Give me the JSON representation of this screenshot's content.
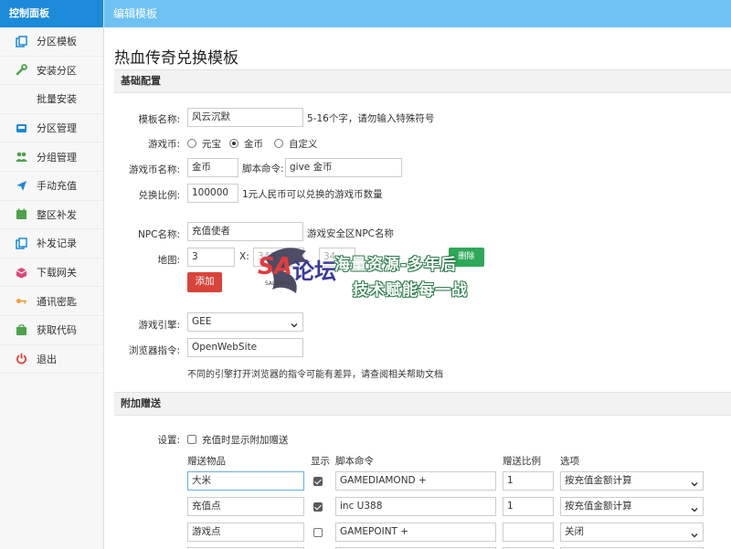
{
  "sidebar": {
    "title": "控制面板",
    "items": [
      {
        "label": "分区模板",
        "icon": "copy-icon",
        "color": "#1a8ad9"
      },
      {
        "label": "安装分区",
        "icon": "wrench-icon",
        "color": "#4aa34a"
      },
      {
        "label": "批量安装",
        "icon": "",
        "color": ""
      },
      {
        "label": "分区管理",
        "icon": "inbox-icon",
        "color": "#1a8ad9"
      },
      {
        "label": "分组管理",
        "icon": "users-icon",
        "color": "#4aa34a"
      },
      {
        "label": "手动充值",
        "icon": "send-icon",
        "color": "#1a8ad9"
      },
      {
        "label": "整区补发",
        "icon": "calendar-icon",
        "color": "#4aa34a"
      },
      {
        "label": "补发记录",
        "icon": "copy-icon",
        "color": "#1a8ad9"
      },
      {
        "label": "下载网关",
        "icon": "box-icon",
        "color": "#e0457b"
      },
      {
        "label": "通讯密匙",
        "icon": "key-icon",
        "color": "#f0a030"
      },
      {
        "label": "获取代码",
        "icon": "code-icon",
        "color": "#4aa34a"
      },
      {
        "label": "退出",
        "icon": "power-icon",
        "color": "#d9443a"
      }
    ]
  },
  "topbar": {
    "title": "编辑模板"
  },
  "page": {
    "title": "热血传奇兑换模板"
  },
  "basic": {
    "section": "基础配置",
    "template_name_label": "模板名称:",
    "template_name_value": "风云沉默",
    "template_name_hint": "5-16个字，请勿输入特殊符号",
    "currency_label": "游戏币:",
    "currency_options": [
      "元宝",
      "金币",
      "自定义"
    ],
    "currency_name_label": "游戏币名称:",
    "currency_name_value": "金币",
    "script_cmd_label": "脚本命令:",
    "script_cmd_value": "give 金币",
    "ratio_label": "兑换比例:",
    "ratio_value": "100000",
    "ratio_hint": "1元人民币可以兑换的游戏币数量",
    "npc_label": "NPC名称:",
    "npc_value": "充值使者",
    "npc_hint": "游戏安全区NPC名称",
    "map_label": "地图:",
    "map_value": "3",
    "x_label": "X:",
    "x_value": "343",
    "y_value": "34",
    "delete_label": "删除",
    "add_label": "添加",
    "engine_label": "游戏引擎:",
    "engine_value": "GEE",
    "browser_label": "浏览器指令:",
    "browser_value": "OpenWebSite",
    "browser_hint": "不同的引擎打开浏览器的指令可能有差异，请查阅相关帮助文档"
  },
  "bonus": {
    "section": "附加赠送",
    "settings_label": "设置:",
    "show_bonus_label": "充值时显示附加赠送",
    "columns": [
      "赠送物品",
      "显示",
      "脚本命令",
      "赠送比例",
      "选项"
    ],
    "rows": [
      {
        "item": "大米",
        "shown": true,
        "cmd": "GAMEDIAMOND +",
        "ratio": "1",
        "option": "按充值金额计算"
      },
      {
        "item": "充值点",
        "shown": true,
        "cmd": "inc U388",
        "ratio": "1",
        "option": "按充值金额计算"
      },
      {
        "item": "游戏点",
        "shown": false,
        "cmd": "GAMEPOINT +",
        "ratio": "",
        "option": "关闭"
      }
    ]
  },
  "watermark": {
    "logo": "SA",
    "logo_text": "论坛",
    "logo_sub": "SALENTAS",
    "line1": "海量资源-多年后",
    "line2": "技术赋能每一战"
  }
}
